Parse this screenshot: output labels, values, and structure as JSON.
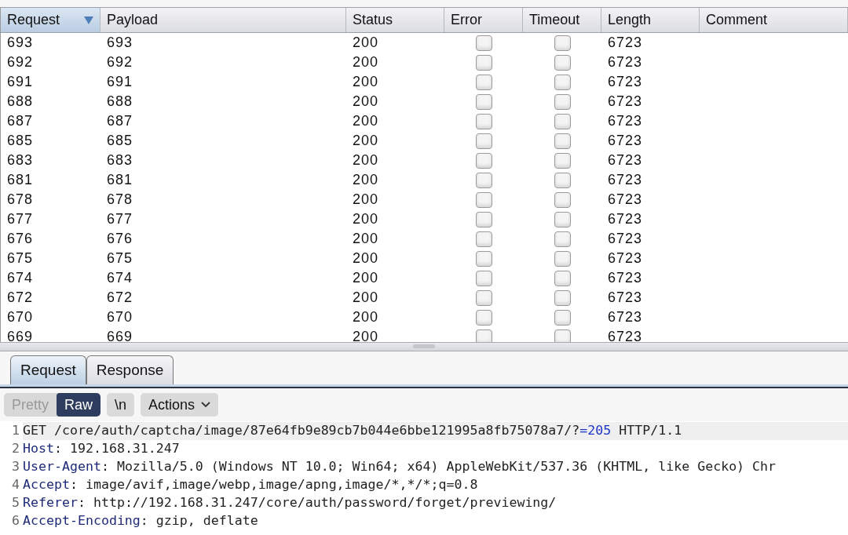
{
  "table": {
    "columns": [
      {
        "label": "Request",
        "sorted": true
      },
      {
        "label": "Payload",
        "sorted": false
      },
      {
        "label": "Status",
        "sorted": false
      },
      {
        "label": "Error",
        "sorted": false
      },
      {
        "label": "Timeout",
        "sorted": false
      },
      {
        "label": "Length",
        "sorted": false
      },
      {
        "label": "Comment",
        "sorted": false
      }
    ],
    "rows": [
      {
        "request": "693",
        "payload": "693",
        "status": "200",
        "error": false,
        "timeout": false,
        "length": "6723"
      },
      {
        "request": "692",
        "payload": "692",
        "status": "200",
        "error": false,
        "timeout": false,
        "length": "6723"
      },
      {
        "request": "691",
        "payload": "691",
        "status": "200",
        "error": false,
        "timeout": false,
        "length": "6723"
      },
      {
        "request": "688",
        "payload": "688",
        "status": "200",
        "error": false,
        "timeout": false,
        "length": "6723"
      },
      {
        "request": "687",
        "payload": "687",
        "status": "200",
        "error": false,
        "timeout": false,
        "length": "6723"
      },
      {
        "request": "685",
        "payload": "685",
        "status": "200",
        "error": false,
        "timeout": false,
        "length": "6723"
      },
      {
        "request": "683",
        "payload": "683",
        "status": "200",
        "error": false,
        "timeout": false,
        "length": "6723"
      },
      {
        "request": "681",
        "payload": "681",
        "status": "200",
        "error": false,
        "timeout": false,
        "length": "6723"
      },
      {
        "request": "678",
        "payload": "678",
        "status": "200",
        "error": false,
        "timeout": false,
        "length": "6723"
      },
      {
        "request": "677",
        "payload": "677",
        "status": "200",
        "error": false,
        "timeout": false,
        "length": "6723"
      },
      {
        "request": "676",
        "payload": "676",
        "status": "200",
        "error": false,
        "timeout": false,
        "length": "6723"
      },
      {
        "request": "675",
        "payload": "675",
        "status": "200",
        "error": false,
        "timeout": false,
        "length": "6723"
      },
      {
        "request": "674",
        "payload": "674",
        "status": "200",
        "error": false,
        "timeout": false,
        "length": "6723"
      },
      {
        "request": "672",
        "payload": "672",
        "status": "200",
        "error": false,
        "timeout": false,
        "length": "6723"
      },
      {
        "request": "670",
        "payload": "670",
        "status": "200",
        "error": false,
        "timeout": false,
        "length": "6723"
      },
      {
        "request": "669",
        "payload": "669",
        "status": "200",
        "error": false,
        "timeout": false,
        "length": "6723"
      }
    ]
  },
  "tabs": [
    {
      "label": "Request",
      "selected": true
    },
    {
      "label": "Response",
      "selected": false
    }
  ],
  "view_modes": [
    {
      "label": "Pretty",
      "selected": false
    },
    {
      "label": "Raw",
      "selected": true
    }
  ],
  "newline_button": "\\n",
  "actions_button": "Actions",
  "editor": {
    "lines": [
      {
        "number": "1",
        "highlighted": true,
        "parts": [
          {
            "kind": "plain",
            "text": "GET /core/auth/captcha/image/87e64fb9e89cb7b044e6bbe121995a8fb75078a7/?"
          },
          {
            "kind": "param",
            "text": "=205"
          },
          {
            "kind": "plain",
            "text": " HTTP/1.1"
          }
        ]
      },
      {
        "number": "2",
        "highlighted": false,
        "parts": [
          {
            "kind": "header",
            "text": "Host"
          },
          {
            "kind": "plain",
            "text": ": 192.168.31.247"
          }
        ]
      },
      {
        "number": "3",
        "highlighted": false,
        "parts": [
          {
            "kind": "header",
            "text": "User-Agent"
          },
          {
            "kind": "plain",
            "text": ": Mozilla/5.0 (Windows NT 10.0; Win64; x64) AppleWebKit/537.36 (KHTML, like Gecko) Chr"
          }
        ]
      },
      {
        "number": "4",
        "highlighted": false,
        "parts": [
          {
            "kind": "header",
            "text": "Accept"
          },
          {
            "kind": "plain",
            "text": ": image/avif,image/webp,image/apng,image/*,*/*;q=0.8"
          }
        ]
      },
      {
        "number": "5",
        "highlighted": false,
        "parts": [
          {
            "kind": "header",
            "text": "Referer"
          },
          {
            "kind": "plain",
            "text": ": http://192.168.31.247/core/auth/password/forget/previewing/"
          }
        ]
      },
      {
        "number": "6",
        "highlighted": false,
        "parts": [
          {
            "kind": "header",
            "text": "Accept-Encoding"
          },
          {
            "kind": "plain",
            "text": ": gzip, deflate"
          }
        ]
      }
    ]
  }
}
